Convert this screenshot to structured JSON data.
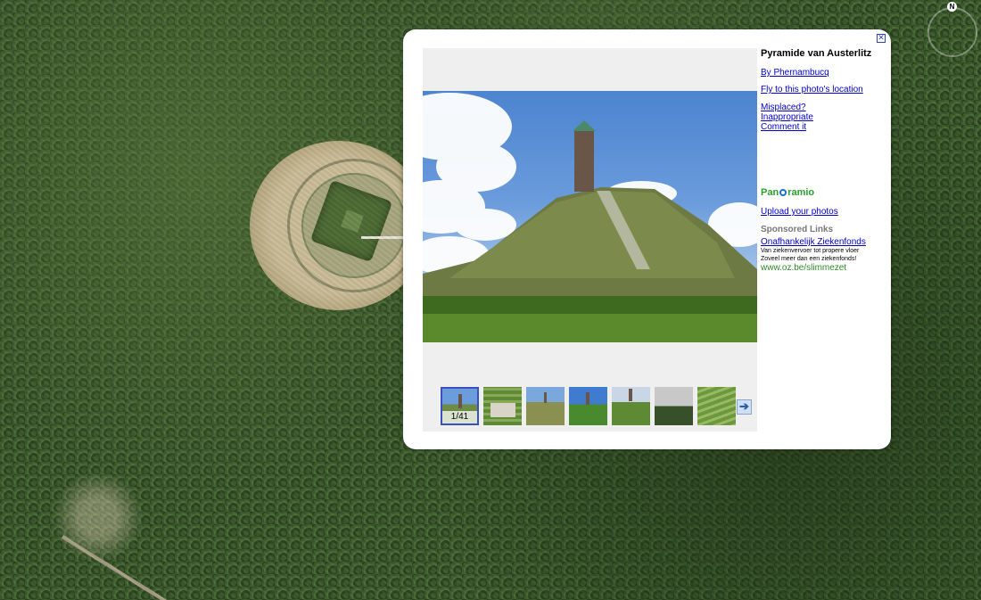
{
  "map": {
    "compass_label": "N"
  },
  "balloon": {
    "close_symbol": "✕",
    "title": "Pyramide van Austerlitz",
    "author_link": "By Phernambucq",
    "fly_link": "Fly to this photo's location",
    "report_links": [
      "Misplaced?",
      "Inappropriate",
      "Comment it"
    ],
    "logo_left": "Pan",
    "logo_right": "ramio",
    "upload_link": "Upload your photos",
    "thumbnail_counter": "1/41",
    "next_symbol": "➔"
  },
  "sponsored": {
    "header": "Sponsored Links",
    "ad_title": "Onafhankelijk Ziekenfonds",
    "ad_line1": "Van ziekenvervoer tot propere vloer",
    "ad_line2": "Zoveel meer dan een ziekenfonds!",
    "ad_url": "www.oz.be/slimmezet"
  },
  "colors": {
    "link": "#0000cc",
    "panoramio_green": "#2aa02a",
    "ad_url_green": "#2a8a2a"
  }
}
